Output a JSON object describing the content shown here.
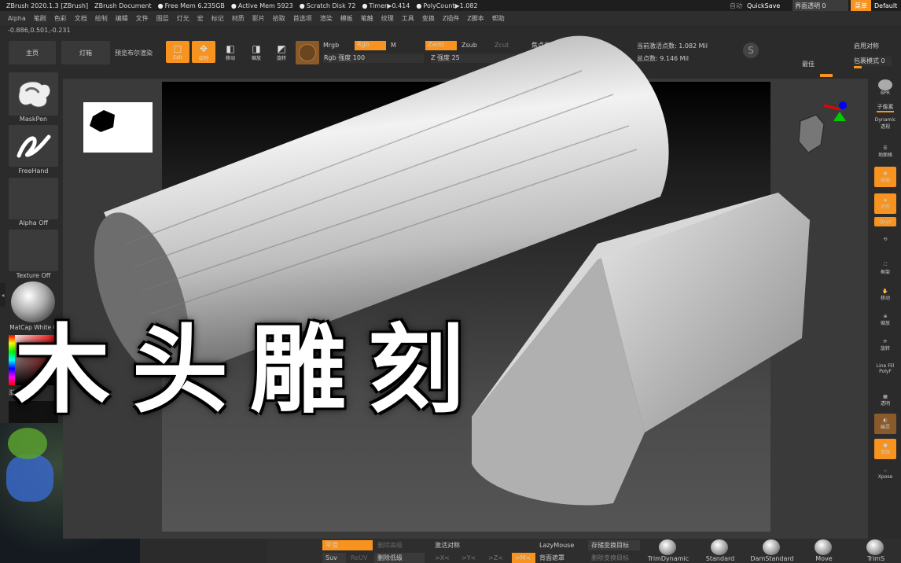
{
  "titlebar": {
    "app": "ZBrush 2020.1.3 [ZBrush]",
    "doc": "ZBrush Document",
    "free_mem": "Free Mem 6.235GB",
    "active_mem": "Active Mem 5923",
    "scratch": "Scratch Disk 72",
    "timer": "Timer▶0.414",
    "polycount": "PolyCount▶1.082",
    "autosave": "自动",
    "quicksave": "QuickSave",
    "ui_transparency": "界面透明 0",
    "menu": "菜单",
    "default": "Default"
  },
  "menubar": [
    "Alpha",
    "笔刷",
    "色彩",
    "文档",
    "绘制",
    "编辑",
    "文件",
    "图层",
    "灯光",
    "宏",
    "标记",
    "材质",
    "影片",
    "拾取",
    "首选项",
    "渲染",
    "模板",
    "笔触",
    "纹理",
    "工具",
    "变换",
    "Z插件",
    "Z脚本",
    "帮助"
  ],
  "coords": "-0.886,0.501,-0.231",
  "shelf": {
    "home": "主页",
    "lightbox": "灯箱",
    "preview": "预览布尔渲染",
    "edit": "Edit",
    "draw": "绘制",
    "move": "移动",
    "scale": "缩放",
    "rotate": "旋转",
    "mrgb": "Mrgb",
    "rgb": "Rgb",
    "m": "M",
    "rgb_intensity": "Rgb 强度 100",
    "zadd": "Zadd",
    "zsub": "Zsub",
    "zcut": "Zcut",
    "z_intensity": "Z 强度 25",
    "focal": "焦点衰减",
    "active_points": "当前激活点数: 1.082 Mil",
    "total_points": "总点数: 9.146 Mil",
    "best": "最佳",
    "enable_sym": "启用对称",
    "wrap_mode": "包裹模式 0"
  },
  "left_panel": {
    "brush": "MaskPen",
    "stroke": "FreeHand",
    "alpha": "Alpha Off",
    "texture": "Texture Off",
    "material": "MatCap White C",
    "gradient": "渐变"
  },
  "right_panel": {
    "bpr": "BPR",
    "subpixel": "子像素",
    "dynamic": "Dynamic",
    "persp": "透视",
    "floor": "地面格",
    "local": "局部",
    "align": "对齐",
    "xyz": "Qxyz",
    "frame": "框架",
    "move": "移动",
    "scale": "缩放",
    "rotate": "旋转",
    "linefill": "Line Fill",
    "polyf": "PolyF",
    "transp": "透明",
    "ghost": "幽灵",
    "solo": "单独",
    "xpose": "Xpose"
  },
  "bottom": {
    "smooth": "平滑",
    "del_higher": "删除高级",
    "activate_sym": "激活对称",
    "lazymouse": "LazyMouse",
    "store_morph": "存储变换目标",
    "suv": "Suv",
    "reuv": "ReUV",
    "del_lower": "删除低级",
    "x": ">X<",
    "y": ">Y<",
    "z": ">Z<",
    "m": ">M<",
    "backface": "背面遮罩",
    "del_morph": "删除变换目标",
    "brushes": [
      "TrimDynamic",
      "Standard",
      "DamStandard",
      "Move",
      "TrimS"
    ]
  },
  "overlay_title": [
    "木",
    "头",
    "雕",
    "刻"
  ],
  "colors": {
    "accent": "#f7931e",
    "bg": "#2b2b2b"
  }
}
